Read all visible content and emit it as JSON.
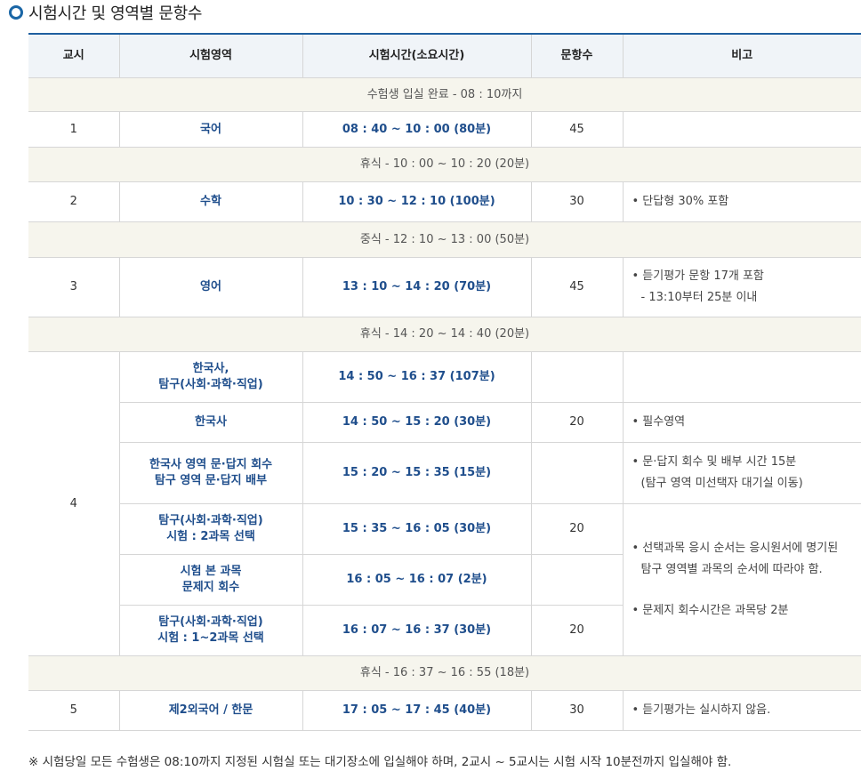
{
  "title": "시험시간 및 영역별 문항수",
  "headers": [
    "교시",
    "시험영역",
    "시험시간(소요시간)",
    "문항수",
    "비고"
  ],
  "bands": {
    "entry": "수험생 입실 완료 - 08 : 10까지",
    "break1": "휴식 - 10 : 00 ~ 10 : 20 (20분)",
    "lunch": "중식 - 12 : 10 ~ 13 : 00 (50분)",
    "break2": "휴식 - 14 : 20 ~ 14 : 40 (20분)",
    "break3": "휴식 - 16 : 37 ~ 16 : 55 (18분)"
  },
  "p1": {
    "period": "1",
    "area": "국어",
    "time": "08 : 40 ~ 10 : 00 (80분)",
    "count": "45",
    "note": ""
  },
  "p2": {
    "period": "2",
    "area": "수학",
    "time": "10 : 30 ~ 12 : 10 (100분)",
    "count": "30",
    "note": "• 단답형 30% 포함"
  },
  "p3": {
    "period": "3",
    "area": "영어",
    "time": "13 : 10 ~ 14 : 20 (70분)",
    "count": "45",
    "note1": "• 듣기평가 문항 17개 포함",
    "note2": "- 13:10부터 25분 이내"
  },
  "p4": {
    "period": "4",
    "r1": {
      "area1": "한국사,",
      "area2": "탐구(사회·과학·직업)",
      "time": "14 : 50 ~ 16 : 37 (107분)"
    },
    "r2": {
      "area": "한국사",
      "time": "14 : 50 ~ 15 : 20 (30분)",
      "count": "20",
      "note": "• 필수영역"
    },
    "r3": {
      "area1": "한국사 영역 문·답지 회수",
      "area2": "탐구 영역 문·답지 배부",
      "time": "15 : 20 ~ 15 : 35 (15분)",
      "note1": "• 문·답지 회수 및 배부 시간 15분",
      "note2": "(탐구 영역 미선택자 대기실 이동)"
    },
    "r4": {
      "area1": "탐구(사회·과학·직업)",
      "area2": "시험 : 2과목 선택",
      "time": "15 : 35 ~ 16 : 05 (30분)",
      "count": "20"
    },
    "r5": {
      "area1": "시험 본 과목",
      "area2": "문제지 회수",
      "time": "16 : 05 ~ 16 : 07 (2분)"
    },
    "r6": {
      "area1": "탐구(사회·과학·직업)",
      "area2": "시험 : 1~2과목 선택",
      "time": "16 : 07 ~ 16 : 37 (30분)",
      "count": "20"
    },
    "note_a1": "• 선택과목 응시 순서는 응시원서에 명기된",
    "note_a2": "탐구 영역별 과목의 순서에 따라야 함.",
    "note_b": "• 문제지 회수시간은 과목당 2분"
  },
  "p5": {
    "period": "5",
    "area": "제2외국어 / 한문",
    "time": "17 : 05 ~ 17 : 45 (40분)",
    "count": "30",
    "note": "• 듣기평가는 실시하지 않음."
  },
  "footnote": "※ 시험당일 모든 수험생은 08:10까지 지정된 시험실 또는 대기장소에 입실해야 하며, 2교시 ~ 5교시는 시험 시작 10분전까지 입실해야 함.",
  "colors": {
    "accent": "#1f5fa0",
    "band_bg": "#f6f5ed",
    "header_bg": "#f0f4f8",
    "area_text": "#1f4e8c"
  },
  "icons": {
    "title_bullet": "ring-bullet-icon"
  }
}
